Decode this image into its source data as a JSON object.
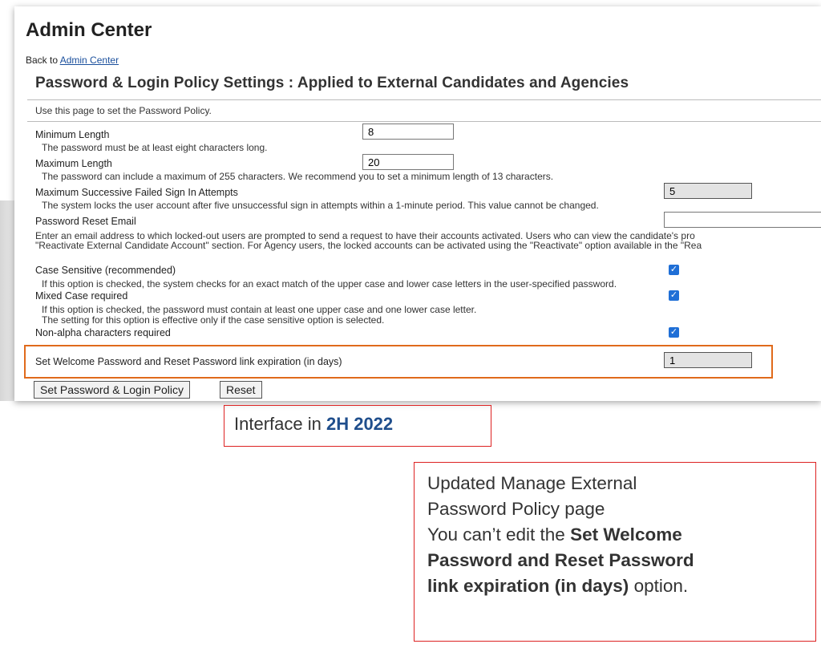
{
  "header": {
    "app_title": "Admin Center",
    "back_prefix": "Back to",
    "back_link": "Admin Center",
    "page_title": "Password & Login Policy Settings : Applied to External Candidates and Agencies",
    "instructions": "Use this page to set the Password Policy."
  },
  "settings": {
    "min_length": {
      "label": "Minimum Length",
      "value": "8",
      "desc": "The password must be at least eight characters long."
    },
    "max_length": {
      "label": "Maximum Length",
      "value": "20",
      "desc": "The password can include a maximum of 255 characters. We recommend you to set a minimum length of 13 characters."
    },
    "max_failed": {
      "label": "Maximum Successive Failed Sign In Attempts",
      "value": "5",
      "desc": "The system locks the user account after five unsuccessful sign in attempts within a 1-minute period. This value cannot be changed."
    },
    "reset_email": {
      "label": "Password Reset Email",
      "value": "",
      "desc1": "Enter an email address to which locked-out users are prompted to send a request to have their accounts activated. Users who can view the candidate's pro",
      "desc2": "\"Reactivate External Candidate Account\" section. For Agency users, the locked accounts can be activated using the \"Reactivate\" option available in the \"Rea"
    },
    "case_sensitive": {
      "label": "Case Sensitive (recommended)",
      "checked": true,
      "desc": "If this option is checked, the system checks for an exact match of the upper case and lower case letters in the user-specified password."
    },
    "mixed_case": {
      "label": "Mixed Case required",
      "checked": true,
      "desc1": "If this option is checked, the password must contain at least one upper case and one lower case letter.",
      "desc2": "The setting for this option is effective only if the case sensitive option is selected."
    },
    "non_alpha": {
      "label": "Non-alpha characters required",
      "checked": true
    },
    "link_expiration": {
      "label": "Set Welcome Password and Reset Password link expiration (in days)",
      "value": "1"
    }
  },
  "buttons": {
    "submit": "Set Password & Login Policy",
    "reset": "Reset"
  },
  "annotations": {
    "interface_prefix": "Interface in",
    "interface_version": "2H 2022",
    "note_line1": "Updated Manage External",
    "note_line2": "Password Policy page",
    "note_line3": "You can’t edit the",
    "note_bold1": "Set Welcome",
    "note_bold2": "Password and Reset Password",
    "note_bold3": "link expiration (in days)",
    "note_end": "option."
  },
  "colors": {
    "highlight_border": "#e06a1b",
    "annotation_border": "#dd2222",
    "version_text": "#1f4e8c",
    "checkbox": "#1f6fd6"
  }
}
